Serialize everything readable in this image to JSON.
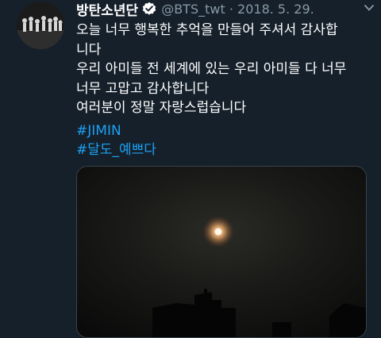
{
  "tweet": {
    "display_name": "방탄소년단",
    "handle": "@BTS_twt",
    "separator": "·",
    "date": "2018. 5. 29.",
    "lines": [
      "오늘 너무 행복한 추억을 만들어 주셔서 감사합",
      "니다",
      "우리 아미들 전 세계에 있는 우리 아미들 다 너무",
      "너무 고맙고 감사합니다",
      "여러분이  정말 자랑스럽습니다"
    ],
    "hashtags": [
      "#JIMIN",
      "#달도_예쁘다"
    ]
  },
  "icons": {
    "verified": "verified-badge-icon",
    "more": "chevron-down-icon"
  },
  "colors": {
    "background": "#15202b",
    "text": "#ffffff",
    "secondary": "#8899a6",
    "hashtag": "#1da1f2"
  }
}
